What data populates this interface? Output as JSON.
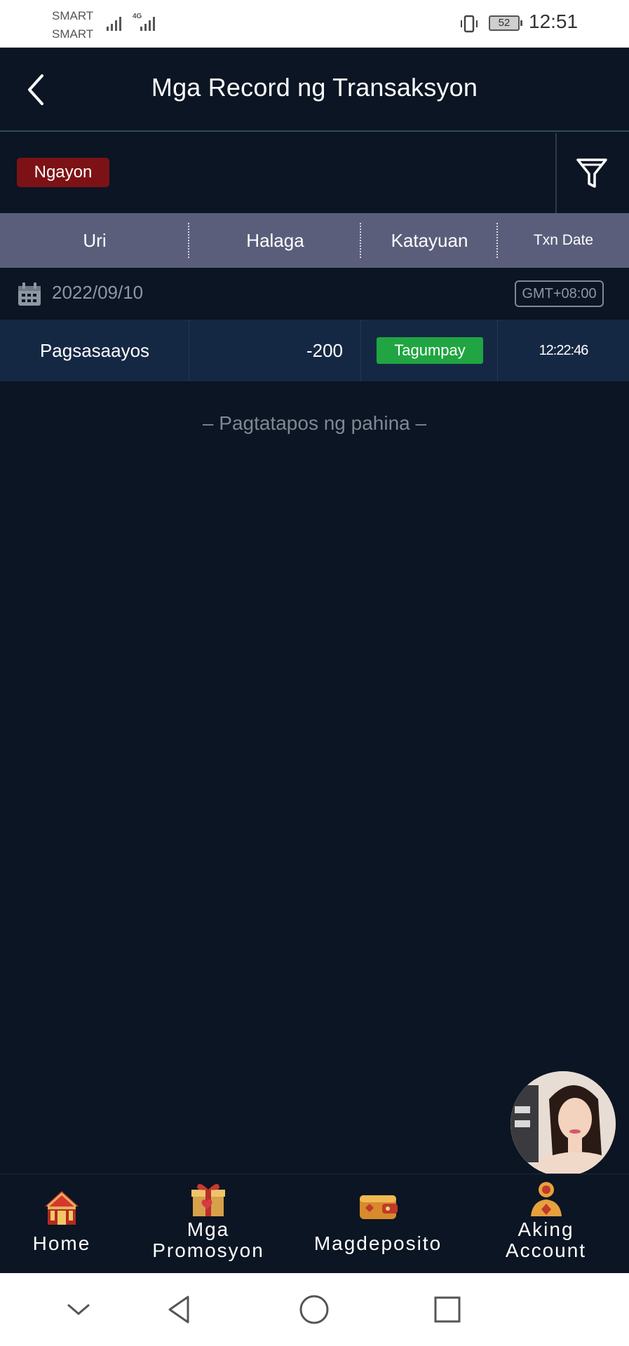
{
  "status_bar": {
    "carrier_1": "SMART",
    "carrier_2": "SMART",
    "network": "4G",
    "battery": "52",
    "time": "12:51"
  },
  "header": {
    "title": "Mga Record ng Transaksyon",
    "back_icon": "chevron-left-icon"
  },
  "filter": {
    "selected_period": "Ngayon",
    "filter_icon": "funnel-icon",
    "accent_color": "#7c1215"
  },
  "table": {
    "columns": [
      "Uri",
      "Halaga",
      "Katayuan",
      "Txn Date"
    ],
    "date_group": {
      "date": "2022/09/10",
      "timezone": "GMT+08:00",
      "icon": "calendar-icon"
    },
    "rows": [
      {
        "type": "Pagsasaayos",
        "amount": "-200",
        "status": "Tagumpay",
        "time": "12:22:46",
        "status_color": "#20a542"
      }
    ],
    "end_message": "–  Pagtatapos ng pahina  –"
  },
  "bottom_nav": {
    "items": [
      {
        "label_1": "Home",
        "label_2": "",
        "icon": "home-icon"
      },
      {
        "label_1": "Mga",
        "label_2": "Promosyon",
        "icon": "gift-icon"
      },
      {
        "label_1": "Magdeposito",
        "label_2": "",
        "icon": "wallet-icon"
      },
      {
        "label_1": "Aking",
        "label_2": "Account",
        "icon": "account-icon"
      }
    ]
  },
  "system_nav": {
    "icons": [
      "chevron-down-icon",
      "back-triangle-icon",
      "home-circle-icon",
      "recents-square-icon"
    ]
  }
}
